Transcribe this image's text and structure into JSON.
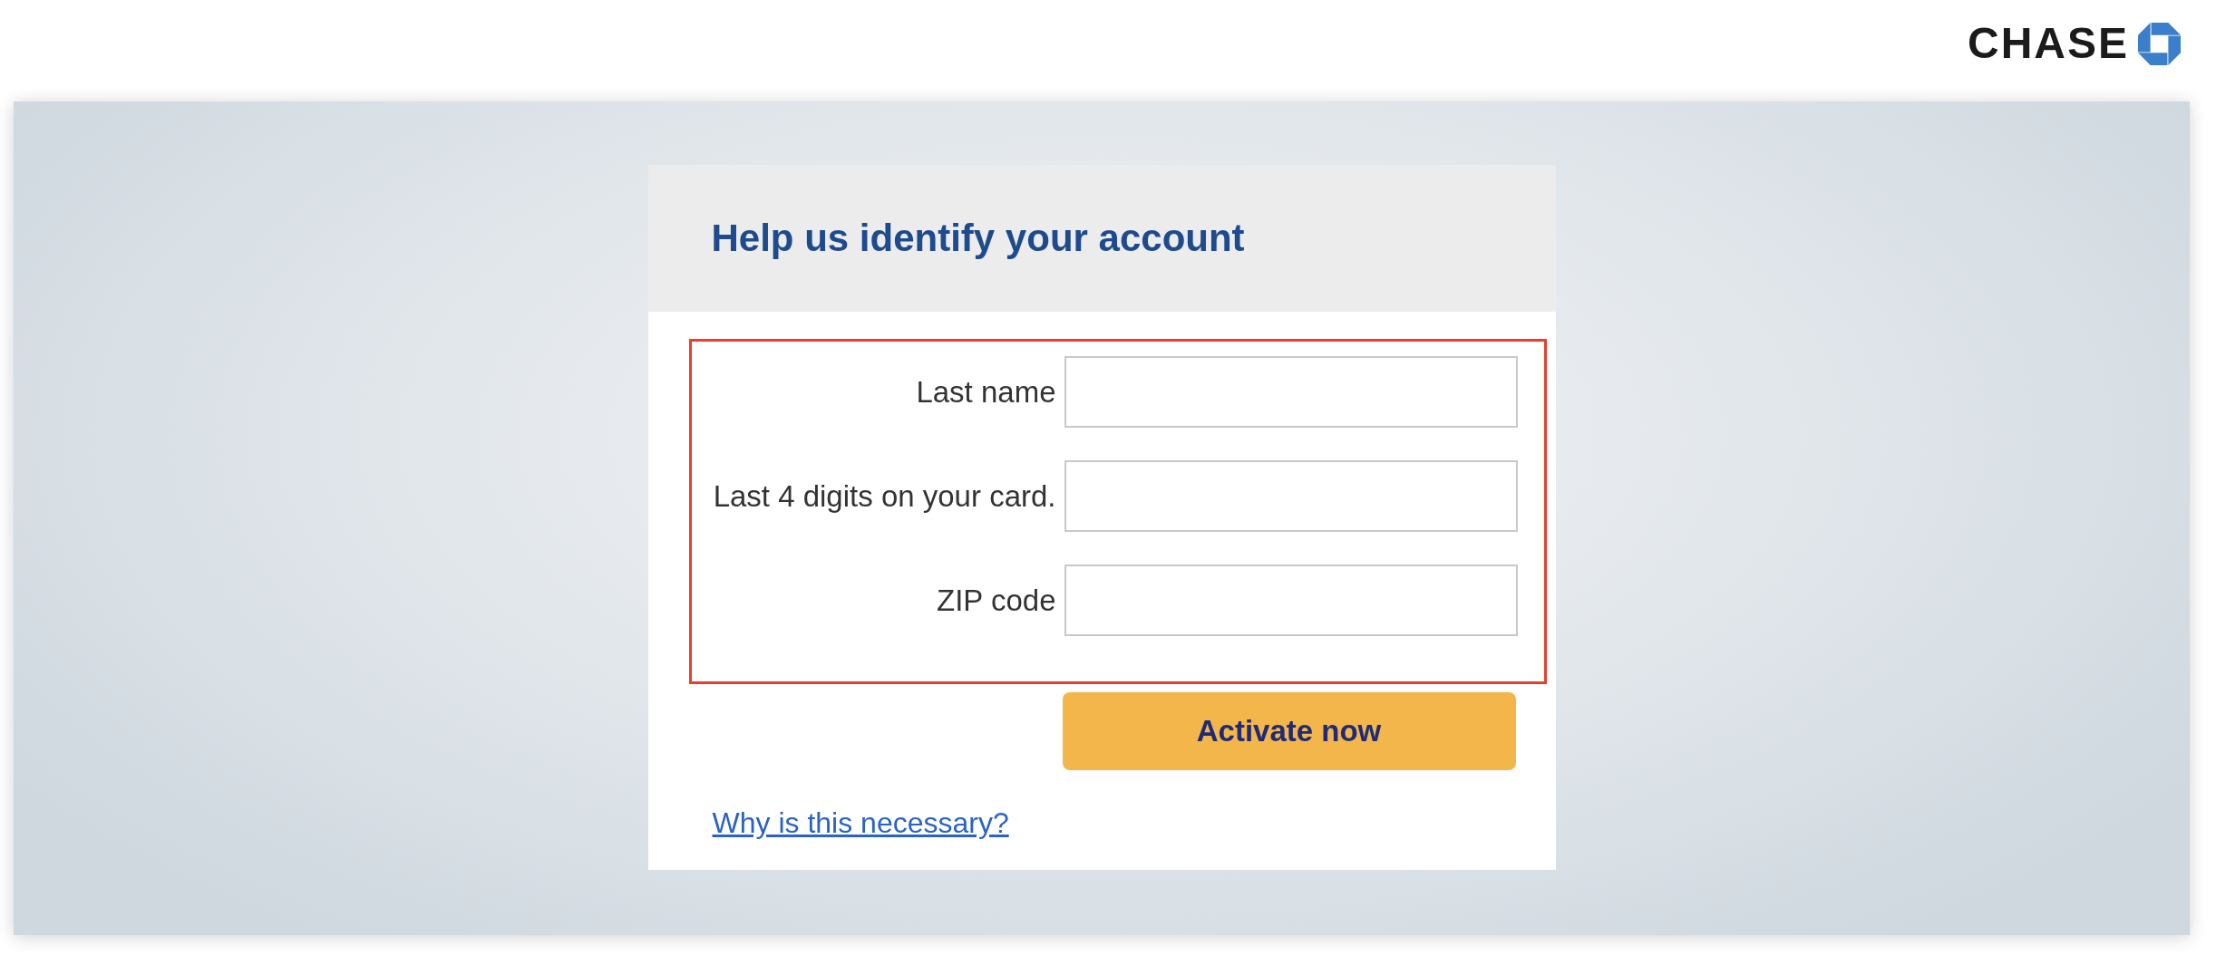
{
  "header": {
    "logo_text": "CHASE"
  },
  "card": {
    "title": "Help us identify your account",
    "field_group": {
      "highlighted": true,
      "fields": [
        {
          "label": "Last name"
        },
        {
          "label": "Last 4 digits on your card."
        },
        {
          "label": "ZIP code"
        }
      ]
    },
    "submit_button": "Activate now",
    "help_link": "Why is this necessary?"
  }
}
